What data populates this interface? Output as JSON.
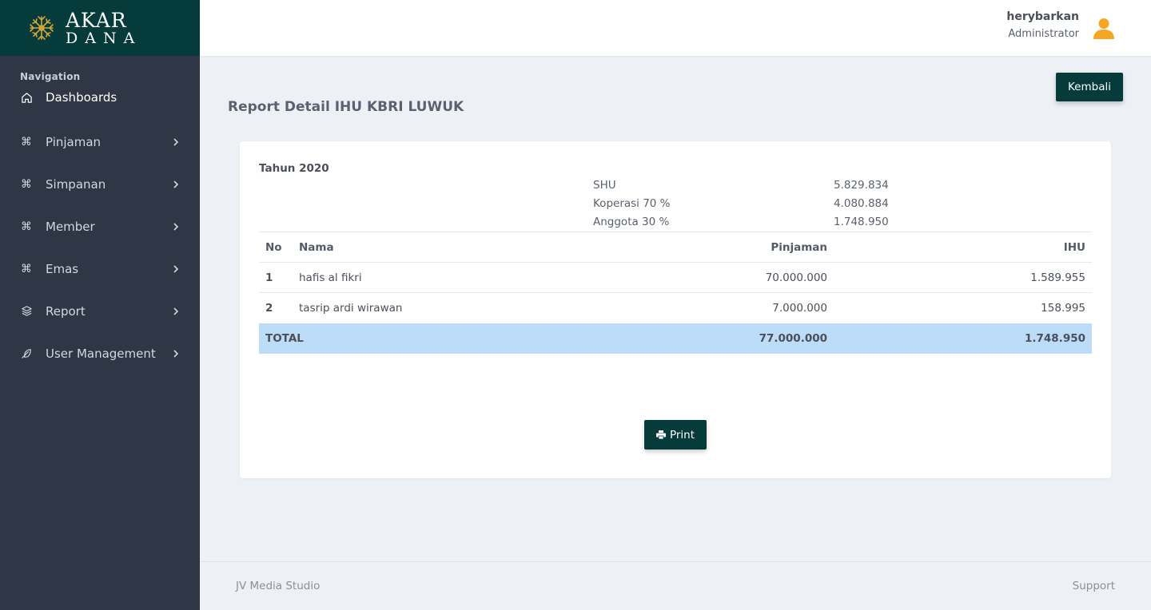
{
  "brand": {
    "line1": "AKAR",
    "line2": "DANA",
    "logo_icon": "tree-roots-icon",
    "logo_color": "#d4a437"
  },
  "sidebar": {
    "heading": "Navigation",
    "items": [
      {
        "label": "Dashboards",
        "icon": "home-icon",
        "has_submenu": false
      },
      {
        "label": "Pinjaman",
        "icon": "command-icon",
        "has_submenu": true
      },
      {
        "label": "Simpanan",
        "icon": "command-icon",
        "has_submenu": true
      },
      {
        "label": "Member",
        "icon": "command-icon",
        "has_submenu": true
      },
      {
        "label": "Emas",
        "icon": "command-icon",
        "has_submenu": true
      },
      {
        "label": "Report",
        "icon": "layers-icon",
        "has_submenu": true
      },
      {
        "label": "User Management",
        "icon": "feather-icon",
        "has_submenu": true
      }
    ]
  },
  "header": {
    "user_name": "herybarkan",
    "user_role": "Administrator",
    "avatar_icon": "user-icon",
    "avatar_color": "#f5a623"
  },
  "main": {
    "back_button": "Kembali",
    "title": "Report Detail IHU KBRI LUWUK",
    "year_label": "Tahun 2020",
    "summary": [
      {
        "label": "SHU",
        "value": "5.829.834"
      },
      {
        "label": "Koperasi 70 %",
        "value": "4.080.884"
      },
      {
        "label": "Anggota 30 %",
        "value": "1.748.950"
      }
    ],
    "table": {
      "headers": {
        "no": "No",
        "nama": "Nama",
        "pinjaman": "Pinjaman",
        "ihu": "IHU"
      },
      "rows": [
        {
          "no": "1",
          "nama": "hafis al fikri",
          "pinjaman": "70.000.000",
          "ihu": "1.589.955"
        },
        {
          "no": "2",
          "nama": "tasrip ardi wirawan",
          "pinjaman": "7.000.000",
          "ihu": "158.995"
        }
      ],
      "total": {
        "label": "TOTAL",
        "pinjaman": "77.000.000",
        "ihu": "1.748.950"
      }
    },
    "print_button": "Print"
  },
  "footer": {
    "left": "JV Media Studio",
    "right": "Support"
  },
  "colors": {
    "brand_dark": "#053b3a",
    "sidebar_bg": "#2f3645",
    "total_row_bg": "#bcdcf8",
    "page_bg": "#edf0f5"
  }
}
